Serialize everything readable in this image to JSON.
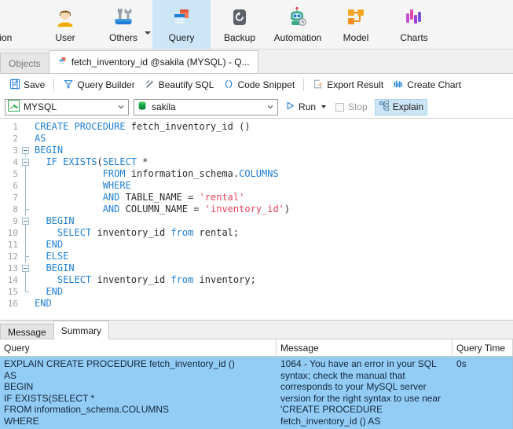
{
  "ribbon": {
    "items": [
      {
        "label": "tion",
        "icon": "partial-clipped-icon",
        "selected": false,
        "clipped": true,
        "caret": false
      },
      {
        "label": "User",
        "icon": "user-icon",
        "selected": false,
        "clipped": false,
        "caret": false
      },
      {
        "label": "Others",
        "icon": "tools-icon",
        "selected": false,
        "clipped": false,
        "caret": true
      },
      {
        "label": "Query",
        "icon": "query-icon",
        "selected": true,
        "clipped": false,
        "caret": false
      },
      {
        "label": "Backup",
        "icon": "backup-icon",
        "selected": false,
        "clipped": false,
        "caret": false
      },
      {
        "label": "Automation",
        "icon": "automation-robot-icon",
        "selected": false,
        "clipped": false,
        "caret": false
      },
      {
        "label": "Model",
        "icon": "model-nodes-icon",
        "selected": false,
        "clipped": false,
        "caret": false
      },
      {
        "label": "Charts",
        "icon": "charts-icon",
        "selected": false,
        "clipped": false,
        "caret": false
      }
    ]
  },
  "tabs": {
    "objects_label": "Objects",
    "active_tab_label": "fetch_inventory_id @sakila (MYSQL) - Q..."
  },
  "toolbar": {
    "save_label": "Save",
    "query_builder_label": "Query Builder",
    "beautify_label": "Beautify SQL",
    "code_snippet_label": "Code Snippet",
    "export_result_label": "Export Result",
    "create_chart_label": "Create Chart"
  },
  "connbar": {
    "connection_value": "MYSQL",
    "database_value": "sakila",
    "run_label": "Run",
    "stop_label": "Stop",
    "explain_label": "Explain"
  },
  "editor": {
    "lines": [
      {
        "n": 1,
        "fold": "none",
        "segs": [
          {
            "t": "CREATE PROCEDURE ",
            "c": "kw"
          },
          {
            "t": "fetch_inventory_id ()",
            "c": "pl"
          }
        ],
        "indent": 0
      },
      {
        "n": 2,
        "fold": "none",
        "segs": [
          {
            "t": "AS",
            "c": "kw"
          }
        ],
        "indent": 0
      },
      {
        "n": 3,
        "fold": "box",
        "segs": [
          {
            "t": "BEGIN",
            "c": "kw"
          }
        ],
        "indent": 0
      },
      {
        "n": 4,
        "fold": "box",
        "segs": [
          {
            "t": "  IF EXISTS",
            "c": "kw"
          },
          {
            "t": "(",
            "c": "pl"
          },
          {
            "t": "SELECT",
            "c": "kw"
          },
          {
            "t": " *",
            "c": "pl"
          }
        ],
        "indent": 0
      },
      {
        "n": 5,
        "fold": "line",
        "segs": [
          {
            "t": "            ",
            "c": "pl"
          },
          {
            "t": "FROM",
            "c": "kw"
          },
          {
            "t": " information_schema.",
            "c": "pl"
          },
          {
            "t": "COLUMNS",
            "c": "kw"
          }
        ],
        "indent": 0
      },
      {
        "n": 6,
        "fold": "line",
        "segs": [
          {
            "t": "            ",
            "c": "pl"
          },
          {
            "t": "WHERE",
            "c": "kw"
          }
        ],
        "indent": 0
      },
      {
        "n": 7,
        "fold": "line",
        "segs": [
          {
            "t": "            ",
            "c": "pl"
          },
          {
            "t": "AND",
            "c": "kw"
          },
          {
            "t": " TABLE_NAME = ",
            "c": "pl"
          },
          {
            "t": "'rental'",
            "c": "str"
          }
        ],
        "indent": 0
      },
      {
        "n": 8,
        "fold": "tick",
        "segs": [
          {
            "t": "            ",
            "c": "pl"
          },
          {
            "t": "AND",
            "c": "kw"
          },
          {
            "t": " COLUMN_NAME = ",
            "c": "pl"
          },
          {
            "t": "'inventory_id'",
            "c": "str"
          },
          {
            "t": ")",
            "c": "pl"
          }
        ],
        "indent": 0
      },
      {
        "n": 9,
        "fold": "box",
        "segs": [
          {
            "t": "  BEGIN",
            "c": "kw"
          }
        ],
        "indent": 0
      },
      {
        "n": 10,
        "fold": "line",
        "segs": [
          {
            "t": "    ",
            "c": "pl"
          },
          {
            "t": "SELECT",
            "c": "kw"
          },
          {
            "t": " inventory_id ",
            "c": "pl"
          },
          {
            "t": "from",
            "c": "kw"
          },
          {
            "t": " rental;",
            "c": "pl"
          }
        ],
        "indent": 0
      },
      {
        "n": 11,
        "fold": "line",
        "segs": [
          {
            "t": "  END",
            "c": "kw"
          }
        ],
        "indent": 0
      },
      {
        "n": 12,
        "fold": "tick",
        "segs": [
          {
            "t": "  ELSE",
            "c": "kw"
          }
        ],
        "indent": 0
      },
      {
        "n": 13,
        "fold": "box",
        "segs": [
          {
            "t": "  BEGIN",
            "c": "kw"
          }
        ],
        "indent": 0
      },
      {
        "n": 14,
        "fold": "line",
        "segs": [
          {
            "t": "    ",
            "c": "pl"
          },
          {
            "t": "SELECT",
            "c": "kw"
          },
          {
            "t": " inventory_id ",
            "c": "pl"
          },
          {
            "t": "from",
            "c": "kw"
          },
          {
            "t": " inventory;",
            "c": "pl"
          }
        ],
        "indent": 0
      },
      {
        "n": 15,
        "fold": "end",
        "segs": [
          {
            "t": "  END",
            "c": "kw"
          }
        ],
        "indent": 0
      },
      {
        "n": 16,
        "fold": "none",
        "segs": [
          {
            "t": "END",
            "c": "kw"
          }
        ],
        "indent": 0
      }
    ]
  },
  "results": {
    "tabs": [
      {
        "label": "Message",
        "active": false
      },
      {
        "label": "Summary",
        "active": true
      }
    ],
    "columns": [
      "Query",
      "Message",
      "Query Time"
    ],
    "rows": [
      {
        "query": "EXPLAIN CREATE PROCEDURE fetch_inventory_id ()\nAS\nBEGIN\nIF EXISTS(SELECT *\nFROM information_schema.COLUMNS\nWHERE",
        "message": "1064 - You have an error in your SQL syntax; check the manual that corresponds to your MySQL server version for the right syntax to use near 'CREATE PROCEDURE fetch_inventory_id ()\nAS",
        "query_time": "0s"
      }
    ]
  },
  "colors": {
    "accent": "#1f7fd6",
    "selection": "#93cdf5",
    "ribbon_selected": "#cde6f7",
    "keyword": "#1f7fd6",
    "string": "#e8425a"
  }
}
